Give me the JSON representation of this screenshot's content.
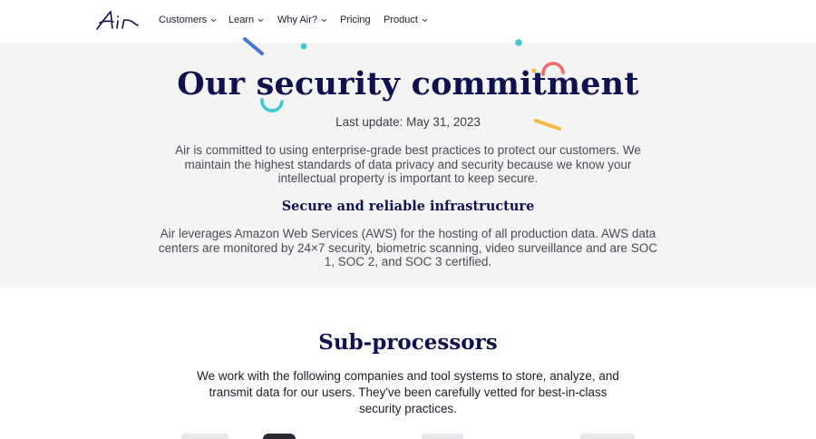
{
  "nav": {
    "brand": "Air",
    "items": [
      {
        "label": "Customers",
        "has_dropdown": true
      },
      {
        "label": "Learn",
        "has_dropdown": true
      },
      {
        "label": "Why Air?",
        "has_dropdown": true
      },
      {
        "label": "Pricing",
        "has_dropdown": false
      },
      {
        "label": "Product",
        "has_dropdown": true
      }
    ]
  },
  "hero": {
    "title": "Our security commitment",
    "last_update": "Last update: May 31, 2023",
    "intro": "Air is committed to using enterprise-grade best practices to protect our customers. We maintain the highest standards of data privacy and security because we know your intellectual property is important to keep secure.",
    "subheading": "Secure and reliable infrastructure",
    "infrastructure": "Air leverages Amazon Web Services (AWS) for the hosting of all production data. AWS data centers are monitored by 24×7 security, biometric scanning, video surveillance and are SOC 1, SOC 2, and SOC 3 certified."
  },
  "subprocessors": {
    "title": "Sub-processors",
    "description": "We work with the following companies and tool systems to store, analyze, and transmit data for our users. They've been carefully vetted for best-in-class security practices."
  },
  "colors": {
    "navy": "#10124f",
    "hero_bg": "#f4f4f4",
    "accent_blue": "#4a72d6",
    "accent_teal": "#3cc9d6",
    "accent_coral": "#f26b6b",
    "accent_yellow": "#f5b942"
  }
}
